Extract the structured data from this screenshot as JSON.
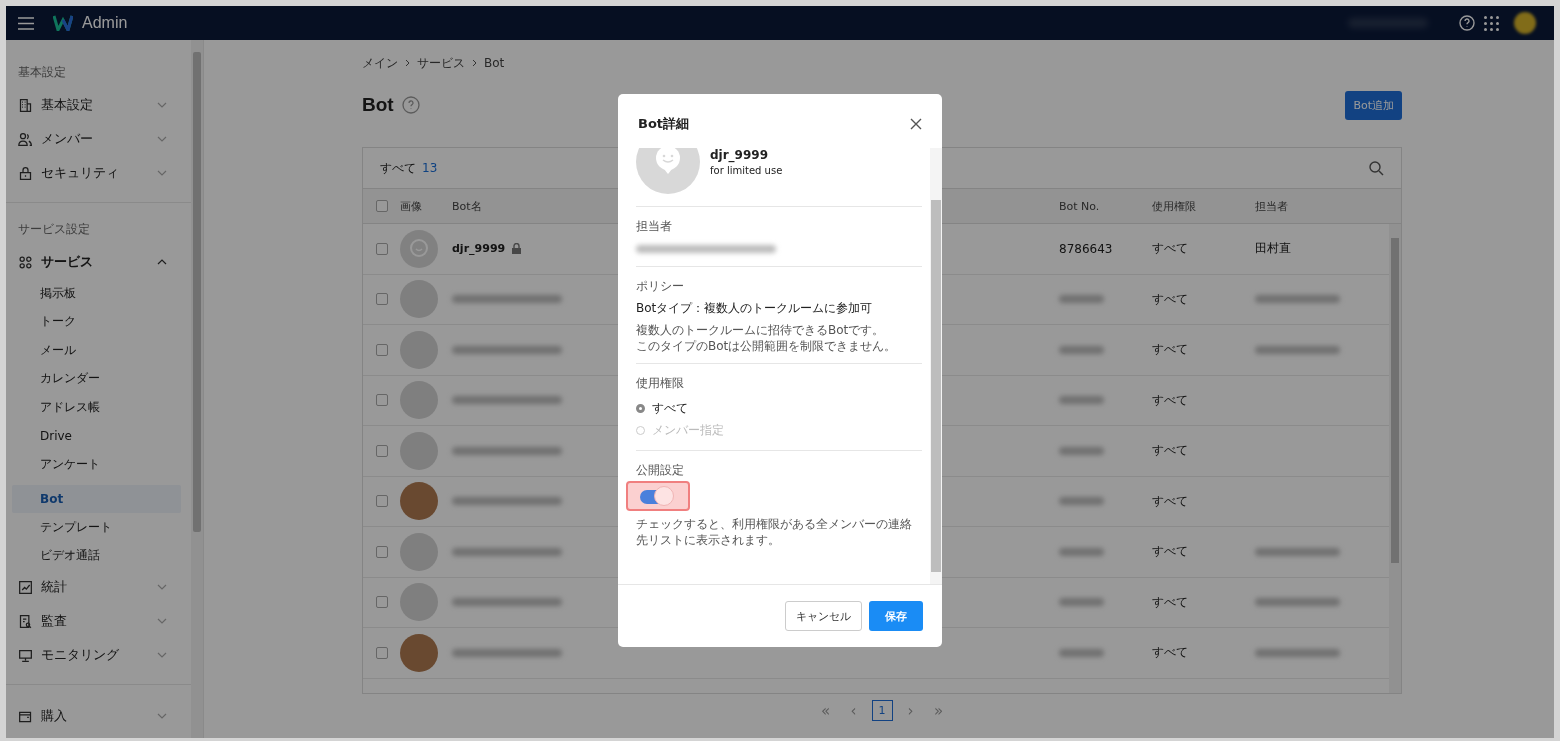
{
  "topbar": {
    "title": "Admin"
  },
  "sidebar": {
    "sections": [
      {
        "heading": "基本設定",
        "items": [
          {
            "label": "基本設定",
            "expanded": false
          },
          {
            "label": "メンバー",
            "expanded": false
          },
          {
            "label": "セキュリティ",
            "expanded": false
          }
        ]
      },
      {
        "heading": "サービス設定",
        "items": [
          {
            "label": "サービス",
            "expanded": true,
            "children": [
              {
                "label": "掲示板",
                "selected": false
              },
              {
                "label": "トーク",
                "selected": false
              },
              {
                "label": "メール",
                "selected": false
              },
              {
                "label": "カレンダー",
                "selected": false
              },
              {
                "label": "アドレス帳",
                "selected": false
              },
              {
                "label": "Drive",
                "selected": false
              },
              {
                "label": "アンケート",
                "selected": false
              },
              {
                "label": "Bot",
                "selected": true
              },
              {
                "label": "テンプレート",
                "selected": false
              },
              {
                "label": "ビデオ通話",
                "selected": false
              }
            ]
          },
          {
            "label": "統計",
            "expanded": false
          },
          {
            "label": "監査",
            "expanded": false
          },
          {
            "label": "モニタリング",
            "expanded": false
          }
        ]
      },
      {
        "items": [
          {
            "label": "購入",
            "expanded": false
          }
        ]
      }
    ]
  },
  "breadcrumb": [
    "メイン",
    "サービス",
    "Bot"
  ],
  "page": {
    "title": "Bot",
    "add_button": "Bot追加"
  },
  "table": {
    "total_label": "すべて",
    "total_count": "13",
    "select_all_checked": false,
    "columns": [
      "画像",
      "Bot名",
      "Bot No.",
      "使用権限",
      "担当者"
    ],
    "rows": [
      {
        "checked": false,
        "kind": "default",
        "name": "djr_9999",
        "locked": true,
        "bot_no": "8786643",
        "permission": "すべて",
        "owner": "田村直"
      },
      {
        "checked": false,
        "kind": "blank",
        "permission": "すべて",
        "owner_redacted": true
      },
      {
        "checked": false,
        "kind": "blank",
        "permission": "すべて",
        "owner_redacted": true
      },
      {
        "checked": false,
        "kind": "blank",
        "permission": "すべて",
        "owner_redacted": false
      },
      {
        "checked": false,
        "kind": "blank",
        "permission": "すべて",
        "owner_redacted": false
      },
      {
        "checked": false,
        "kind": "image",
        "permission": "すべて",
        "owner_redacted": false
      },
      {
        "checked": false,
        "kind": "blank",
        "permission": "すべて",
        "owner_redacted": true
      },
      {
        "checked": false,
        "kind": "blank",
        "permission": "すべて",
        "owner_redacted": true
      },
      {
        "checked": false,
        "kind": "image",
        "permission": "すべて",
        "owner_redacted": true
      }
    ]
  },
  "pager": {
    "first": "«",
    "previous": "‹",
    "current_page": "1",
    "next": "›",
    "last": "»"
  },
  "dialog": {
    "title": "Bot詳細",
    "bot_name": "djr_9999",
    "bot_description": "for limited use",
    "owner_label": "担当者",
    "policy_label": "ポリシー",
    "policy_title": "Botタイプ：複数人のトークルームに参加可",
    "policy_note": [
      "複数人のトークルームに招待できるBotです。",
      "このタイプのBotは公開範囲を制限できません。"
    ],
    "permission_label": "使用権限",
    "permission_options": [
      {
        "label": "すべて",
        "selected": true,
        "disabled": false
      },
      {
        "label": "メンバー指定",
        "selected": false,
        "disabled": true
      }
    ],
    "public_label": "公開設定",
    "public_on": true,
    "public_note": "チェックすると、利用権限がある全メンバーの連絡先リストに表示されます。",
    "cancel": "キャンセル",
    "save": "保存"
  }
}
